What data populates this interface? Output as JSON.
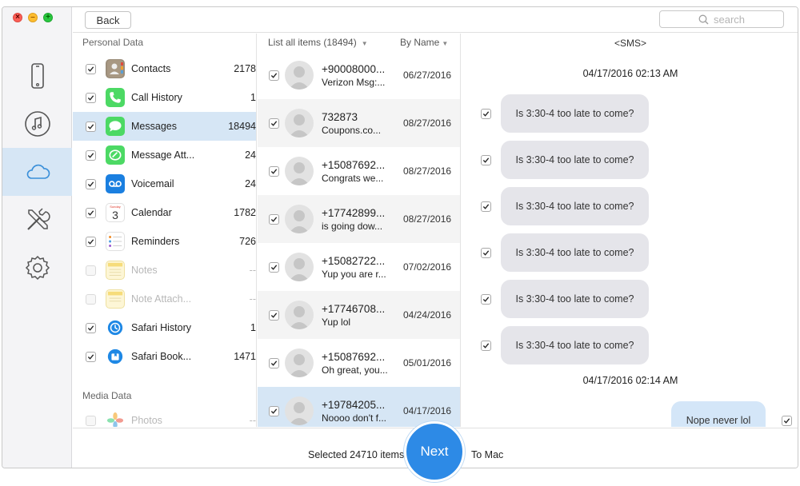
{
  "window": {
    "controls": [
      "close",
      "minimize",
      "zoom"
    ]
  },
  "topbar": {
    "back_label": "Back",
    "search_placeholder": "search"
  },
  "rail": [
    "device-icon",
    "music-icon",
    "cloud-icon",
    "tools-icon",
    "settings-icon"
  ],
  "categories": {
    "personal_label": "Personal Data",
    "media_label": "Media Data",
    "items": [
      {
        "name": "Contacts",
        "count": "2178",
        "checked": true
      },
      {
        "name": "Call History",
        "count": "1",
        "checked": true
      },
      {
        "name": "Messages",
        "count": "18494",
        "checked": true,
        "active": true
      },
      {
        "name": "Message Att...",
        "count": "24",
        "checked": true
      },
      {
        "name": "Voicemail",
        "count": "24",
        "checked": true
      },
      {
        "name": "Calendar",
        "count": "1782",
        "checked": true
      },
      {
        "name": "Reminders",
        "count": "726",
        "checked": true
      },
      {
        "name": "Notes",
        "count": "--",
        "checked": false
      },
      {
        "name": "Note Attach...",
        "count": "--",
        "checked": false
      },
      {
        "name": "Safari History",
        "count": "1",
        "checked": true
      },
      {
        "name": "Safari Book...",
        "count": "1471",
        "checked": true
      }
    ],
    "media_items": [
      {
        "name": "Photos",
        "count": "--",
        "checked": false
      }
    ],
    "calendar_day": "3",
    "calendar_month": "Sunday"
  },
  "list": {
    "header_all": "List all items (18494)",
    "header_sort": "By Name",
    "rows": [
      {
        "name": "+90008000...",
        "preview": "Verizon Msg:...",
        "date": "06/27/2016"
      },
      {
        "name": "732873",
        "preview": "Coupons.co...",
        "date": "08/27/2016"
      },
      {
        "name": "+15087692...",
        "preview": "Congrats we...",
        "date": "08/27/2016"
      },
      {
        "name": "+17742899...",
        "preview": " is going dow...",
        "date": "08/27/2016"
      },
      {
        "name": "+15082722...",
        "preview": "Yup you are r...",
        "date": "07/02/2016"
      },
      {
        "name": "+17746708...",
        "preview": "Yup lol",
        "date": "04/24/2016"
      },
      {
        "name": "+15087692...",
        "preview": "Oh great, you...",
        "date": "05/01/2016"
      },
      {
        "name": "+19784205...",
        "preview": "Noooo don't f...",
        "date": "04/17/2016"
      }
    ]
  },
  "conversation": {
    "title": "<SMS>",
    "stamp1": "04/17/2016 02:13 AM",
    "incoming": [
      "Is 3:30-4 too late to come?",
      "Is 3:30-4 too late to come?",
      "Is 3:30-4 too late to come?",
      "Is 3:30-4 too late to come?",
      "Is 3:30-4 too late to come?",
      "Is 3:30-4 too late to come?"
    ],
    "stamp2": "04/17/2016 02:14 AM",
    "outgoing": "Nope never lol"
  },
  "footer": {
    "selected_text": "Selected 24710 items",
    "next_label": "Next",
    "to_mac": "To Mac"
  },
  "colors": {
    "accent": "#2d8ae6",
    "selection": "#d6e6f5",
    "bubble_in": "#e5e5ea",
    "bubble_out": "#d4e6f8"
  }
}
